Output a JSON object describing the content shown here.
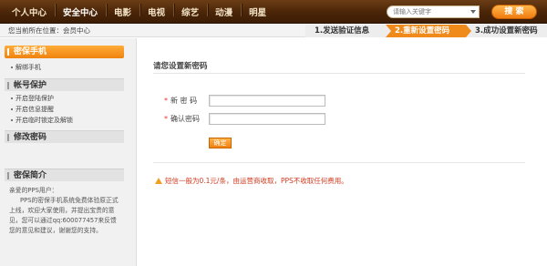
{
  "nav": {
    "items": [
      "个人中心",
      "安全中心",
      "电影",
      "电视",
      "综艺",
      "动漫",
      "明星"
    ],
    "active_index": 1
  },
  "search": {
    "placeholder": "请输入关键字",
    "button_label": "搜 索"
  },
  "location": "您当前所在位置：会员中心",
  "steps": [
    {
      "label": "1.发送验证信息",
      "active": false
    },
    {
      "label": "2.重新设置密码",
      "active": true
    },
    {
      "label": "3.成功设置新密码",
      "active": false
    }
  ],
  "sidebar": {
    "sections": [
      {
        "title": "密保手机",
        "active": true,
        "items": [
          "解绑手机"
        ]
      },
      {
        "title": "帐号保护",
        "active": false,
        "items": [
          "开启登陆保护",
          "开启信息提醒",
          "开启临时锁定及解锁"
        ]
      },
      {
        "title": "修改密码",
        "active": false,
        "items": []
      }
    ],
    "intro": {
      "title": "密保简介",
      "lines": [
        "亲爱的PPS用户：",
        "PPS的密保手机系统免费体验原正式上线，欢迎大家使用，并提出宝贵的意见，您可以通过qq:600077457来反馈您的意见和建议，谢谢您的支持。"
      ]
    }
  },
  "main": {
    "title": "请您设置新密码",
    "new_password_label": "新 密 码",
    "confirm_password_label": "确认密码",
    "new_password_value": "",
    "confirm_password_value": "",
    "submit_label": "确定",
    "notice": "短信一般为0.1元/条，由运营商收取，PPS不收取任何费用。"
  },
  "colors": {
    "accent": "#f08a1b",
    "nav_bg": "#4a2508",
    "notice": "#d13a1f"
  }
}
